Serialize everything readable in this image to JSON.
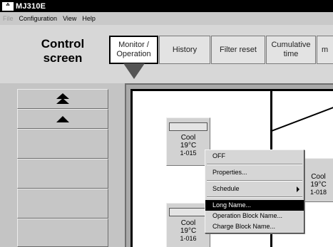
{
  "window": {
    "title": "MJ310E",
    "icon_label": "MITSUBISHI"
  },
  "menu": [
    {
      "label": "File",
      "disabled": true
    },
    {
      "label": "Configuration",
      "disabled": false
    },
    {
      "label": "View",
      "disabled": false
    },
    {
      "label": "Help",
      "disabled": false
    }
  ],
  "header": {
    "title_line1": "Control",
    "title_line2": "screen"
  },
  "tabs": [
    {
      "line1": "Monitor /",
      "line2": "Operation",
      "active": true
    },
    {
      "line1": "History",
      "line2": ""
    },
    {
      "line1": "Filter reset",
      "line2": ""
    },
    {
      "line1": "Cumulative",
      "line2": "time"
    },
    {
      "line1": "m",
      "line2": ""
    }
  ],
  "sidebar": {
    "buttons": [
      "scroll-top",
      "scroll-up",
      "",
      "",
      "",
      ""
    ]
  },
  "units": [
    {
      "mode": "Cool",
      "temp": "19°C",
      "id": "1-015"
    },
    {
      "mode": "Cool",
      "temp": "19°C",
      "id": "1-018"
    },
    {
      "mode": "Cool",
      "temp": "19°C",
      "id": "1-016"
    }
  ],
  "context_menu": {
    "items": [
      "OFF",
      "Properties...",
      "Schedule",
      "Long Name...",
      "Operation Block Name...",
      "Charge Block Name..."
    ],
    "highlighted": "Long Name..."
  }
}
